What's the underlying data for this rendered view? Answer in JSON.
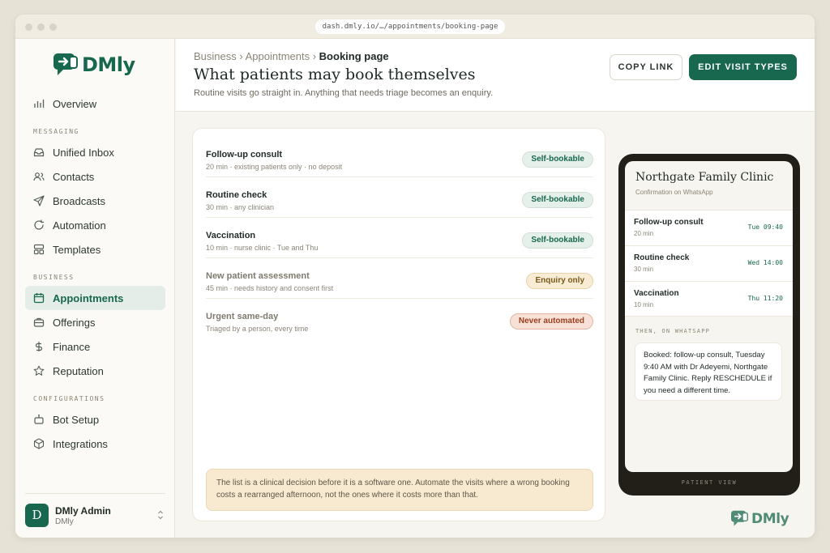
{
  "browser": {
    "url": "dash.dmly.io/…/appointments/booking-page"
  },
  "brand": {
    "name": "DMly",
    "accent": "#17684f"
  },
  "sidebar": {
    "overview": "Overview",
    "sections": {
      "messaging": "MESSAGING",
      "business": "BUSINESS",
      "configurations": "CONFIGURATIONS"
    },
    "messaging_items": [
      "Unified Inbox",
      "Contacts",
      "Broadcasts",
      "Automation",
      "Templates"
    ],
    "business_items": [
      "Appointments",
      "Offerings",
      "Finance",
      "Reputation"
    ],
    "config_items": [
      "Bot Setup",
      "Integrations"
    ],
    "active": "Appointments",
    "user": {
      "initial": "D",
      "name": "DMly Admin",
      "org": "DMly"
    }
  },
  "header": {
    "crumb1": "Business ›",
    "crumb2": "Appointments ›",
    "crumb_current": "Booking page",
    "title": "What patients may book themselves",
    "subtitle": "Routine visits go straight in. Anything that needs triage becomes an enquiry.",
    "copy_link": "COPY LINK",
    "edit_visit_types": "EDIT VISIT TYPES"
  },
  "visit_types": [
    {
      "title": "Follow-up consult",
      "meta": "20 min · existing patients only · no deposit",
      "badge": "Self-bookable",
      "kind": "self"
    },
    {
      "title": "Routine check",
      "meta": "30 min · any clinician",
      "badge": "Self-bookable",
      "kind": "self"
    },
    {
      "title": "Vaccination",
      "meta": "10 min · nurse clinic · Tue and Thu",
      "badge": "Self-bookable",
      "kind": "self"
    },
    {
      "title": "New patient assessment",
      "meta": "45 min · needs history and consent first",
      "badge": "Enquiry only",
      "kind": "enq"
    },
    {
      "title": "Urgent same-day",
      "meta": "Triaged by a person, every time",
      "badge": "Never automated",
      "kind": "never"
    }
  ],
  "note": "The list is a clinical decision before it is a software one. Automate the visits where a wrong booking costs a rearranged afternoon, not the ones where it costs more than that.",
  "phone": {
    "clinic": "Northgate Family Clinic",
    "confirm": "Confirmation on WhatsApp",
    "slots": [
      {
        "title": "Follow-up consult",
        "duration": "20 min",
        "time": "Tue 09:40"
      },
      {
        "title": "Routine check",
        "duration": "30 min",
        "time": "Wed 14:00"
      },
      {
        "title": "Vaccination",
        "duration": "10 min",
        "time": "Thu 11:20"
      }
    ],
    "then_label": "THEN, ON WHATSAPP",
    "message": "Booked: follow-up consult, Tuesday 9:40 AM with Dr Adeyemi, Northgate Family Clinic. Reply RESCHEDULE if you need a different time.",
    "caption": "PATIENT VIEW"
  },
  "icons": {
    "overview": "bar-chart-icon",
    "unified-inbox": "inbox-icon",
    "contacts": "users-icon",
    "broadcasts": "send-icon",
    "automation": "refresh-icon",
    "templates": "layout-icon",
    "appointments": "calendar-icon",
    "offerings": "briefcase-icon",
    "finance": "dollar-icon",
    "reputation": "star-icon",
    "bot-setup": "bot-icon",
    "integrations": "cube-icon"
  }
}
